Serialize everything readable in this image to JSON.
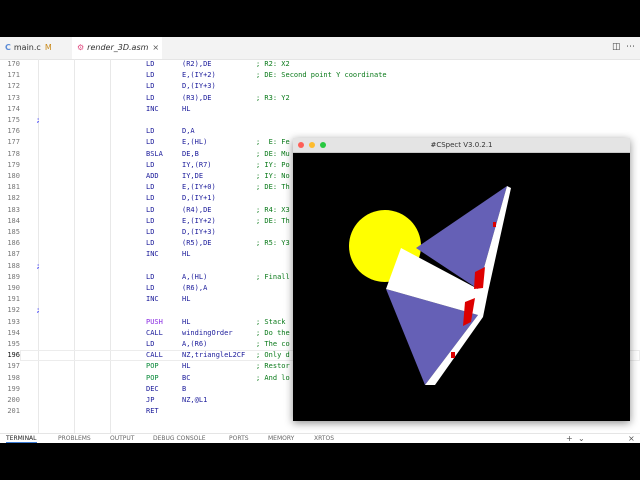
{
  "tabs": [
    {
      "icon": "C",
      "label": "main.c",
      "modified": "M"
    },
    {
      "icon": "asm",
      "label": "render_3D.asm",
      "close": "×"
    }
  ],
  "code_lines": [
    {
      "n": "170",
      "mn": "LD",
      "op": "(R2),DE",
      "cm": "; R2: X2"
    },
    {
      "n": "171",
      "mn": "LD",
      "op": "E,(IY+2)",
      "cm": "; DE: Second point Y coordinate"
    },
    {
      "n": "172",
      "mn": "LD",
      "op": "D,(IY+3)",
      "cm": ""
    },
    {
      "n": "173",
      "mn": "LD",
      "op": "(R3),DE",
      "cm": "; R3: Y2"
    },
    {
      "n": "174",
      "mn": "INC",
      "op": "HL",
      "cm": ""
    },
    {
      "n": "175",
      "label": ";"
    },
    {
      "n": "176",
      "mn": "LD",
      "op": "D,A",
      "cm": ""
    },
    {
      "n": "177",
      "mn": "LD",
      "op": "E,(HL)",
      "cm": ";  E: Fe"
    },
    {
      "n": "178",
      "mn": "BSLA",
      "op": "DE,B",
      "cm": "; DE: Mu"
    },
    {
      "n": "179",
      "mn": "LD",
      "op": "IY,(R7)",
      "cm": "; IY: Po"
    },
    {
      "n": "180",
      "mn": "ADD",
      "op": "IY,DE",
      "cm": "; IY: No"
    },
    {
      "n": "181",
      "mn": "LD",
      "op": "E,(IY+0)",
      "cm": "; DE: Th"
    },
    {
      "n": "182",
      "mn": "LD",
      "op": "D,(IY+1)",
      "cm": ""
    },
    {
      "n": "183",
      "mn": "LD",
      "op": "(R4),DE",
      "cm": "; R4: X3"
    },
    {
      "n": "184",
      "mn": "LD",
      "op": "E,(IY+2)",
      "cm": "; DE: Th"
    },
    {
      "n": "185",
      "mn": "LD",
      "op": "D,(IY+3)",
      "cm": ""
    },
    {
      "n": "186",
      "mn": "LD",
      "op": "(R5),DE",
      "cm": "; R5: Y3"
    },
    {
      "n": "187",
      "mn": "INC",
      "op": "HL",
      "cm": ""
    },
    {
      "n": "188",
      "label": ";"
    },
    {
      "n": "189",
      "mn": "LD",
      "op": "A,(HL)",
      "cm": "; Finall"
    },
    {
      "n": "190",
      "mn": "LD",
      "op": "(R6),A",
      "cm": ""
    },
    {
      "n": "191",
      "mn": "INC",
      "op": "HL",
      "cm": ""
    },
    {
      "n": "192",
      "label": ";"
    },
    {
      "n": "193",
      "mn": "PUSH",
      "op": "HL",
      "cm": "; Stack",
      "kind": "push"
    },
    {
      "n": "194",
      "mn": "CALL",
      "op": "windingOrder",
      "cm": "; Do the"
    },
    {
      "n": "195",
      "mn": "LD",
      "op": "A,(R6)",
      "cm": "; The co"
    },
    {
      "n": "196",
      "mn": "CALL",
      "op": "NZ,triangleL2CF",
      "cm": "; Only d",
      "current": true
    },
    {
      "n": "197",
      "mn": "POP",
      "op": "HL",
      "cm": "; Restor",
      "kind": "pop"
    },
    {
      "n": "198",
      "mn": "POP",
      "op": "BC",
      "cm": "; And lo",
      "kind": "pop"
    },
    {
      "n": "199",
      "mn": "DEC",
      "op": "B",
      "cm": ""
    },
    {
      "n": "200",
      "mn": "JP",
      "op": "NZ,@L1",
      "cm": ""
    },
    {
      "n": "201",
      "mn": "RET",
      "op": "",
      "cm": ""
    }
  ],
  "panel_tabs": [
    "TERMINAL",
    "PROBLEMS",
    "OUTPUT",
    "DEBUG CONSOLE",
    "PORTS",
    "MEMORY",
    "XRTOS"
  ],
  "emulator": {
    "title": "#CSpect V3.0.2.1",
    "colors": {
      "sun": "#ffff00",
      "face_blue": "#6560b6",
      "face_white": "#ffffff",
      "accent_red": "#dd0000",
      "background": "#000000"
    }
  }
}
